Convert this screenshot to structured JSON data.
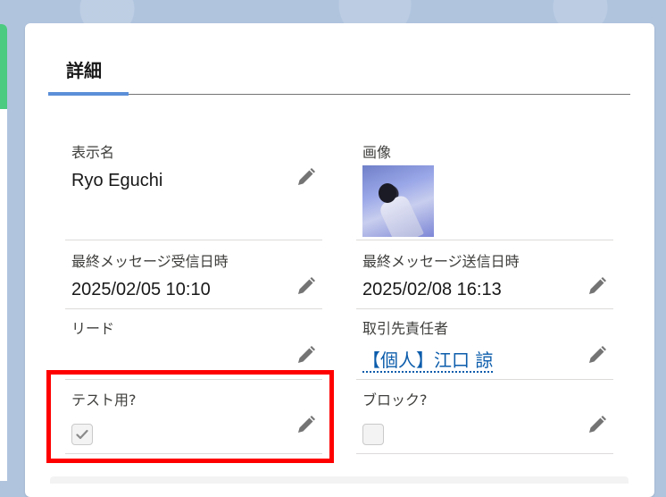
{
  "section": {
    "title": "詳細"
  },
  "fields": {
    "display_name": {
      "label": "表示名",
      "value": "Ryo Eguchi"
    },
    "image": {
      "label": "画像"
    },
    "last_received": {
      "label": "最終メッセージ受信日時",
      "value": "2025/02/05 10:10"
    },
    "last_sent": {
      "label": "最終メッセージ送信日時",
      "value": "2025/02/08 16:13"
    },
    "lead": {
      "label": "リード",
      "value": ""
    },
    "account_owner": {
      "label": "取引先責任者",
      "value": "【個人】江口 諒"
    },
    "test_use": {
      "label": "テスト用?",
      "checked": true
    },
    "blocked": {
      "label": "ブロック?",
      "checked": false
    }
  },
  "colors": {
    "accent": "#5b8fd8",
    "link": "#0b5cab",
    "highlight": "#ff0000",
    "left_accent": "#4bca81"
  },
  "icons": {
    "edit": "pencil-icon",
    "check": "checkmark-icon"
  }
}
